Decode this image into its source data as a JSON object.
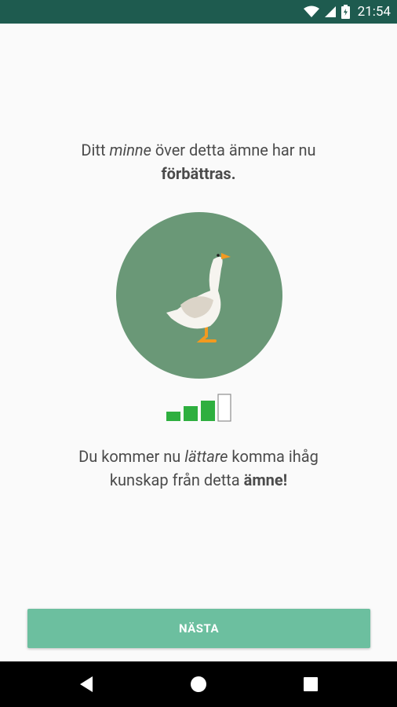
{
  "status_bar": {
    "time": "21:54",
    "icons": [
      "wifi-icon",
      "cellular-signal-icon",
      "battery-icon"
    ],
    "background": "#1e5b4f"
  },
  "message_top": {
    "part1": "Ditt ",
    "emphasis": "minne",
    "part2": " över detta ämne har nu",
    "strong": "förbättras."
  },
  "illustration": {
    "icon": "goose-illustration",
    "circle_color": "#6a9877"
  },
  "memory_strength": {
    "total_levels": 4,
    "filled_levels": 3,
    "filled_color": "#2eaf3f"
  },
  "message_bottom": {
    "part1": "Du kommer nu ",
    "emphasis": "lättare",
    "part2": " komma ihåg",
    "line2": "kunskap från detta ",
    "strong": "ämne!"
  },
  "next_button": {
    "label": "NÄSTA",
    "color": "#6cbf9f"
  },
  "nav_bar": {
    "icons": [
      "back-icon",
      "home-icon",
      "recents-icon"
    ]
  }
}
